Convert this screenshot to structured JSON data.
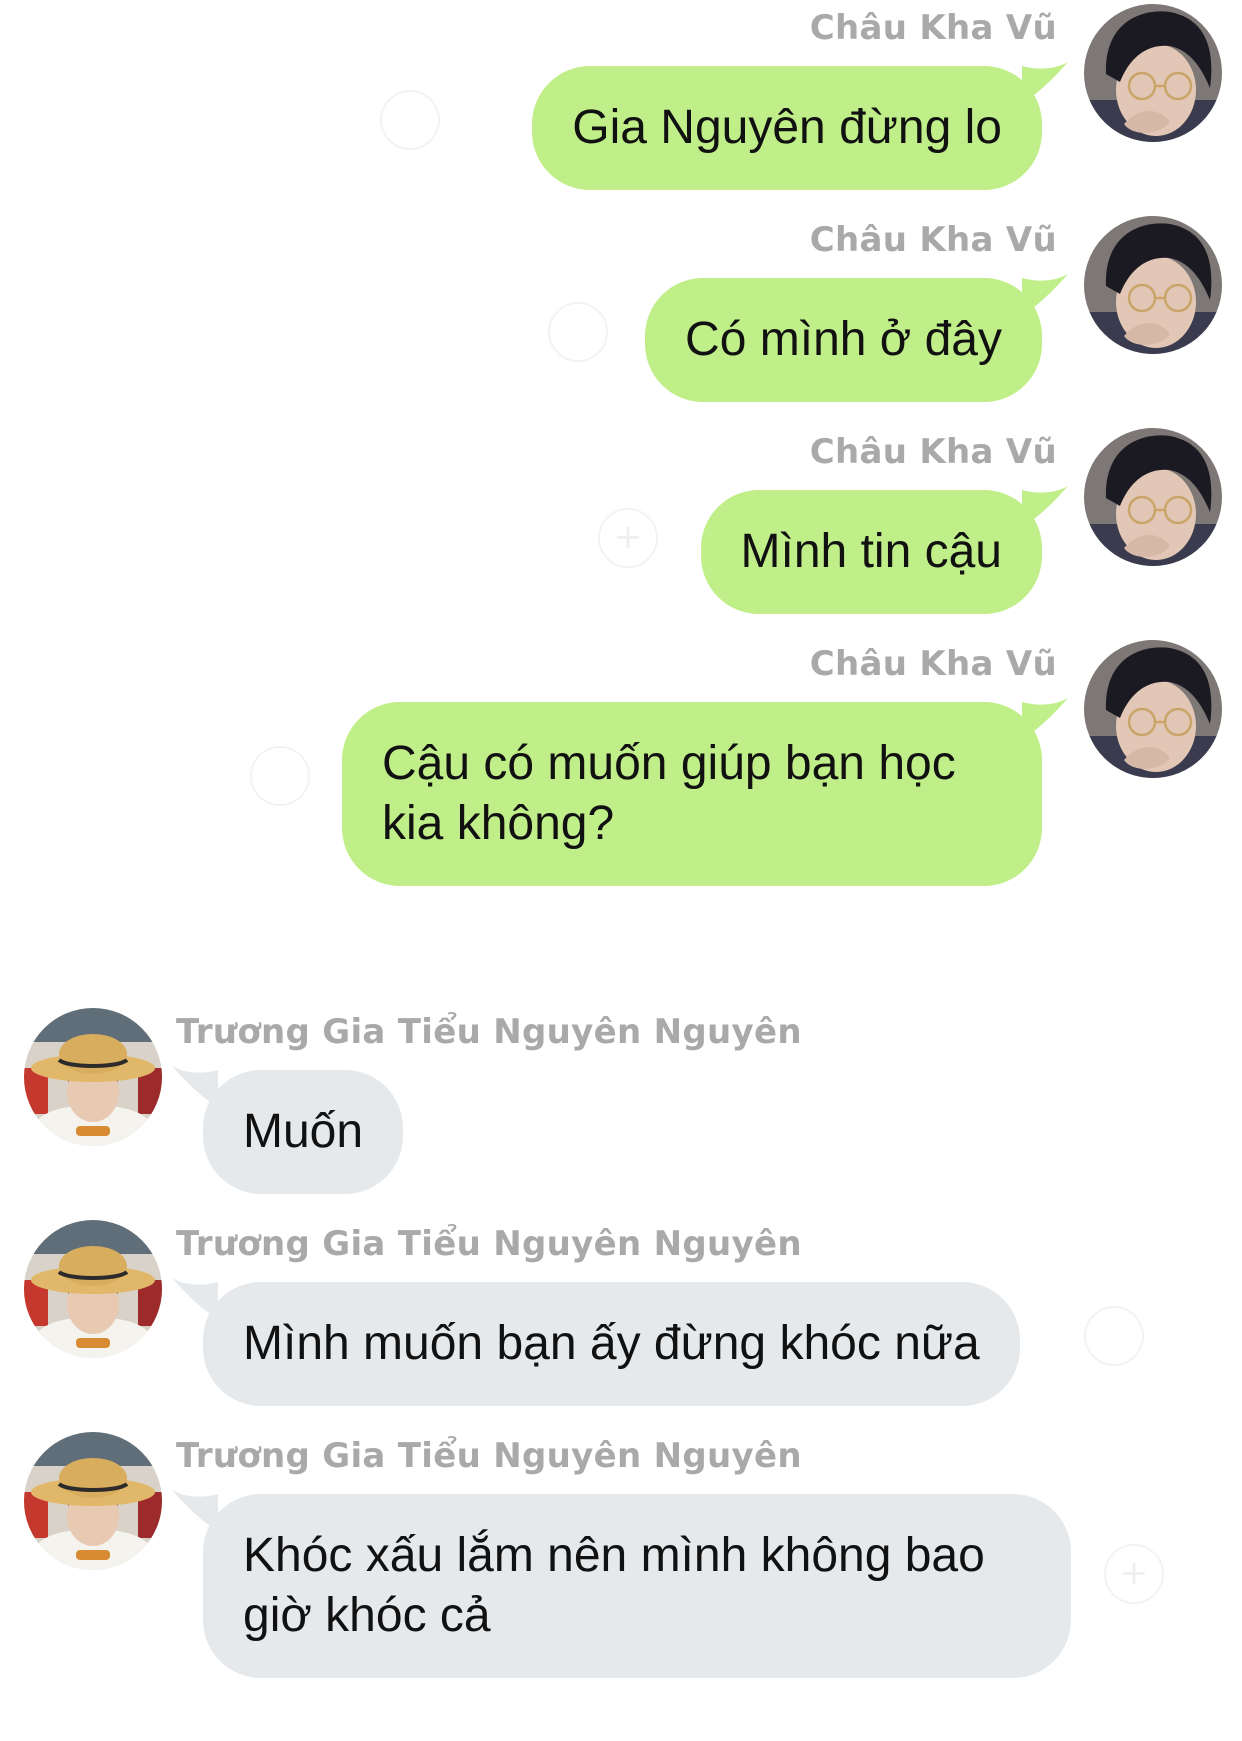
{
  "colors": {
    "outgoing_bubble": "#c0ef8a",
    "incoming_bubble": "#e6e9ec",
    "sender_name": "#a9a9a9",
    "text": "#111111",
    "background": "#ffffff"
  },
  "messages": [
    {
      "direction": "outgoing",
      "sender": "Châu Kha Vũ",
      "lines": [
        "Gia Nguyên đừng lo"
      ],
      "avatar": "avatar-glasses-boy"
    },
    {
      "direction": "outgoing",
      "sender": "Châu Kha Vũ",
      "lines": [
        "Có mình ở đây"
      ],
      "avatar": "avatar-glasses-boy"
    },
    {
      "direction": "outgoing",
      "sender": "Châu Kha Vũ",
      "lines": [
        "Mình tin cậu"
      ],
      "avatar": "avatar-glasses-boy"
    },
    {
      "direction": "outgoing",
      "sender": "Châu Kha Vũ",
      "lines": [
        "Cậu có muốn giúp bạn học",
        "kia không?"
      ],
      "avatar": "avatar-glasses-boy"
    },
    {
      "direction": "incoming",
      "sender": "Trương Gia Tiểu Nguyên Nguyên",
      "lines": [
        "Muốn"
      ],
      "avatar": "avatar-straw-hat-boy"
    },
    {
      "direction": "incoming",
      "sender": "Trương Gia Tiểu Nguyên Nguyên",
      "lines": [
        "Mình muốn bạn ấy đừng khóc nữa"
      ],
      "avatar": "avatar-straw-hat-boy"
    },
    {
      "direction": "incoming",
      "sender": "Trương Gia Tiểu Nguyên Nguyên",
      "lines": [
        "Khóc xấu lắm nên mình không bao",
        "giờ khóc cả"
      ],
      "avatar": "avatar-straw-hat-boy"
    }
  ]
}
